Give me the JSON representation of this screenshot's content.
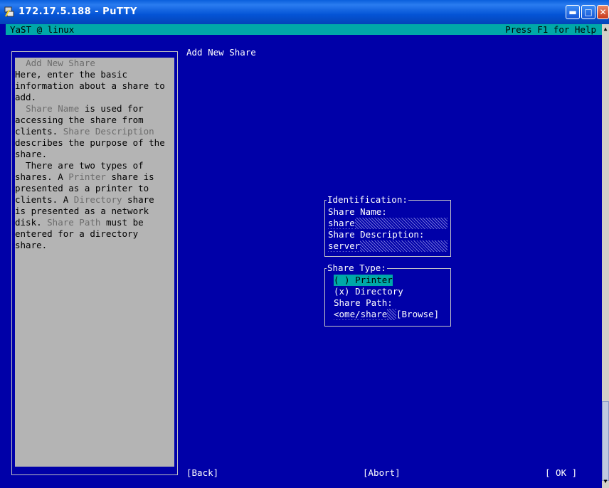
{
  "window": {
    "title": "172.17.5.188 - PuTTY"
  },
  "status_bar": {
    "left": "YaST @ linux",
    "right": "Press F1 for Help"
  },
  "help": {
    "lines": [
      {
        "segs": [
          {
            "t": "  "
          },
          {
            "t": "Add New Share",
            "h": true
          }
        ]
      },
      {
        "segs": [
          {
            "t": "Here, enter the basic"
          }
        ]
      },
      {
        "segs": [
          {
            "t": "information about a share to"
          }
        ]
      },
      {
        "segs": [
          {
            "t": "add."
          }
        ]
      },
      {
        "segs": [
          {
            "t": "  "
          },
          {
            "t": "Share Name",
            "h": true
          },
          {
            "t": " is used for"
          }
        ]
      },
      {
        "segs": [
          {
            "t": "accessing the share from"
          }
        ]
      },
      {
        "segs": [
          {
            "t": "clients. "
          },
          {
            "t": "Share Description",
            "h": true
          }
        ]
      },
      {
        "segs": [
          {
            "t": "describes the purpose of the"
          }
        ]
      },
      {
        "segs": [
          {
            "t": "share."
          }
        ]
      },
      {
        "segs": [
          {
            "t": "  There are two types of"
          }
        ]
      },
      {
        "segs": [
          {
            "t": "shares. A "
          },
          {
            "t": "Printer",
            "h": true
          },
          {
            "t": " share is"
          }
        ]
      },
      {
        "segs": [
          {
            "t": "presented as a printer to"
          }
        ]
      },
      {
        "segs": [
          {
            "t": "clients. A "
          },
          {
            "t": "Directory",
            "h": true
          },
          {
            "t": " share"
          }
        ]
      },
      {
        "segs": [
          {
            "t": "is presented as a network"
          }
        ]
      },
      {
        "segs": [
          {
            "t": "disk. "
          },
          {
            "t": "Share Path",
            "h": true
          },
          {
            "t": " must be"
          }
        ]
      },
      {
        "segs": [
          {
            "t": "entered for a directory"
          }
        ]
      },
      {
        "segs": [
          {
            "t": "share."
          }
        ]
      }
    ]
  },
  "dialog": {
    "title": "Add New Share",
    "identification": {
      "legend": "Identification:",
      "share_name_label": "Share Name:",
      "share_name_value": "share",
      "share_desc_label": "Share Description:",
      "share_desc_value": "server"
    },
    "share_type": {
      "legend": "Share Type:",
      "printer_option": "( ) Printer",
      "directory_option": "(x) Directory",
      "path_label": "Share Path:",
      "path_value": "<ome/share",
      "browse_label": "[Browse]"
    }
  },
  "buttons": {
    "back": "[Back]",
    "abort": "[Abort]",
    "ok": "[ OK ]"
  },
  "colors": {
    "terminal_bg": "#0000a8",
    "help_bg": "#b4b4b4",
    "status_bar_bg": "#00a8a8",
    "focus": "#00a8a8"
  }
}
